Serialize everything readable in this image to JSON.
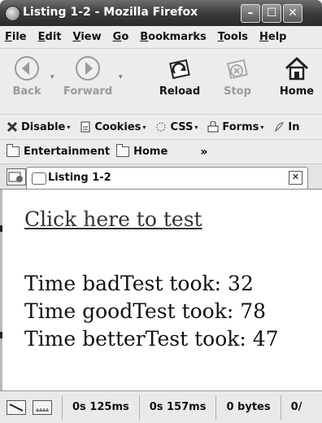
{
  "window": {
    "title": "Listing 1-2 - Mozilla Firefox",
    "controls": {
      "minimize": "–",
      "maximize": "☐",
      "close": "✕"
    }
  },
  "menu": [
    {
      "label": "File",
      "key": "F",
      "rest": "ile"
    },
    {
      "label": "Edit",
      "key": "E",
      "rest": "dit"
    },
    {
      "label": "View",
      "key": "V",
      "rest": "iew"
    },
    {
      "label": "Go",
      "key": "G",
      "rest": "o"
    },
    {
      "label": "Bookmarks",
      "key": "B",
      "rest": "ookmarks"
    },
    {
      "label": "Tools",
      "key": "T",
      "rest": "ools"
    },
    {
      "label": "Help",
      "key": "H",
      "rest": "elp"
    }
  ],
  "nav": {
    "back": "Back",
    "forward": "Forward",
    "reload": "Reload",
    "stop": "Stop",
    "home": "Home"
  },
  "devbar": {
    "disable": "Disable",
    "cookies": "Cookies",
    "css": "CSS",
    "forms": "Forms",
    "images": "In"
  },
  "bookmarks": {
    "items": [
      "Entertainment",
      "Home"
    ],
    "more": "»"
  },
  "tab": {
    "label": "Listing 1-2",
    "close": "✕"
  },
  "content": {
    "link": "Click here to test",
    "results": [
      "Time badTest took: 32",
      "Time goodTest took: 78",
      "Time betterTest took: 47"
    ]
  },
  "status": {
    "time1": "0s 125ms",
    "time2": "0s 157ms",
    "bytes": "0 bytes",
    "tail": "0/"
  }
}
